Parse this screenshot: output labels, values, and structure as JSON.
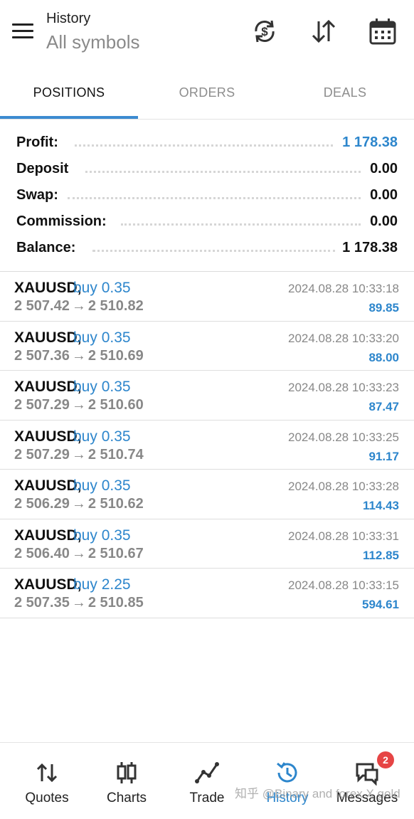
{
  "header": {
    "title": "History",
    "subtitle": "All symbols",
    "icons": [
      "menu-icon",
      "currency-refresh-icon",
      "sort-icon",
      "calendar-icon"
    ]
  },
  "tabs": [
    {
      "label": "POSITIONS",
      "active": true
    },
    {
      "label": "ORDERS",
      "active": false
    },
    {
      "label": "DEALS",
      "active": false
    }
  ],
  "summary": {
    "profit": {
      "label": "Profit:",
      "value": "1 178.38"
    },
    "deposit": {
      "label": "Deposit",
      "value": "0.00"
    },
    "swap": {
      "label": "Swap:",
      "value": "0.00"
    },
    "commission": {
      "label": "Commission:",
      "value": "0.00"
    },
    "balance": {
      "label": "Balance:",
      "value": "1 178.38"
    }
  },
  "positions": [
    {
      "symbol": "XAUUSD,",
      "direction": "buy 0.35",
      "open": "2 507.42",
      "arrow": "→",
      "close": "2 510.82",
      "time": "2024.08.28 10:33:18",
      "profit": "89.85"
    },
    {
      "symbol": "XAUUSD,",
      "direction": "buy 0.35",
      "open": "2 507.36",
      "arrow": "→",
      "close": "2 510.69",
      "time": "2024.08.28 10:33:20",
      "profit": "88.00"
    },
    {
      "symbol": "XAUUSD,",
      "direction": "buy 0.35",
      "open": "2 507.29",
      "arrow": "→",
      "close": "2 510.60",
      "time": "2024.08.28 10:33:23",
      "profit": "87.47"
    },
    {
      "symbol": "XAUUSD,",
      "direction": "buy 0.35",
      "open": "2 507.29",
      "arrow": "→",
      "close": "2 510.74",
      "time": "2024.08.28 10:33:25",
      "profit": "91.17"
    },
    {
      "symbol": "XAUUSD,",
      "direction": "buy 0.35",
      "open": "2 506.29",
      "arrow": "→",
      "close": "2 510.62",
      "time": "2024.08.28 10:33:28",
      "profit": "114.43"
    },
    {
      "symbol": "XAUUSD,",
      "direction": "buy 0.35",
      "open": "2 506.40",
      "arrow": "→",
      "close": "2 510.67",
      "time": "2024.08.28 10:33:31",
      "profit": "112.85"
    },
    {
      "symbol": "XAUUSD,",
      "direction": "buy 2.25",
      "open": "2 507.35",
      "arrow": "→",
      "close": "2 510.85",
      "time": "2024.08.28 10:33:15",
      "profit": "594.61"
    }
  ],
  "bottom_nav": [
    {
      "label": "Quotes",
      "icon": "quotes-icon",
      "active": false
    },
    {
      "label": "Charts",
      "icon": "charts-icon",
      "active": false
    },
    {
      "label": "Trade",
      "icon": "trade-icon",
      "active": false
    },
    {
      "label": "History",
      "icon": "history-icon",
      "active": true
    },
    {
      "label": "Messages",
      "icon": "messages-icon",
      "active": false,
      "badge": "2"
    }
  ],
  "watermark": "知乎 @Binary and forex X gold",
  "colors": {
    "accent": "#2d86cc",
    "indicator": "#3c8bd1",
    "badge": "#e64545",
    "muted": "#888888"
  }
}
